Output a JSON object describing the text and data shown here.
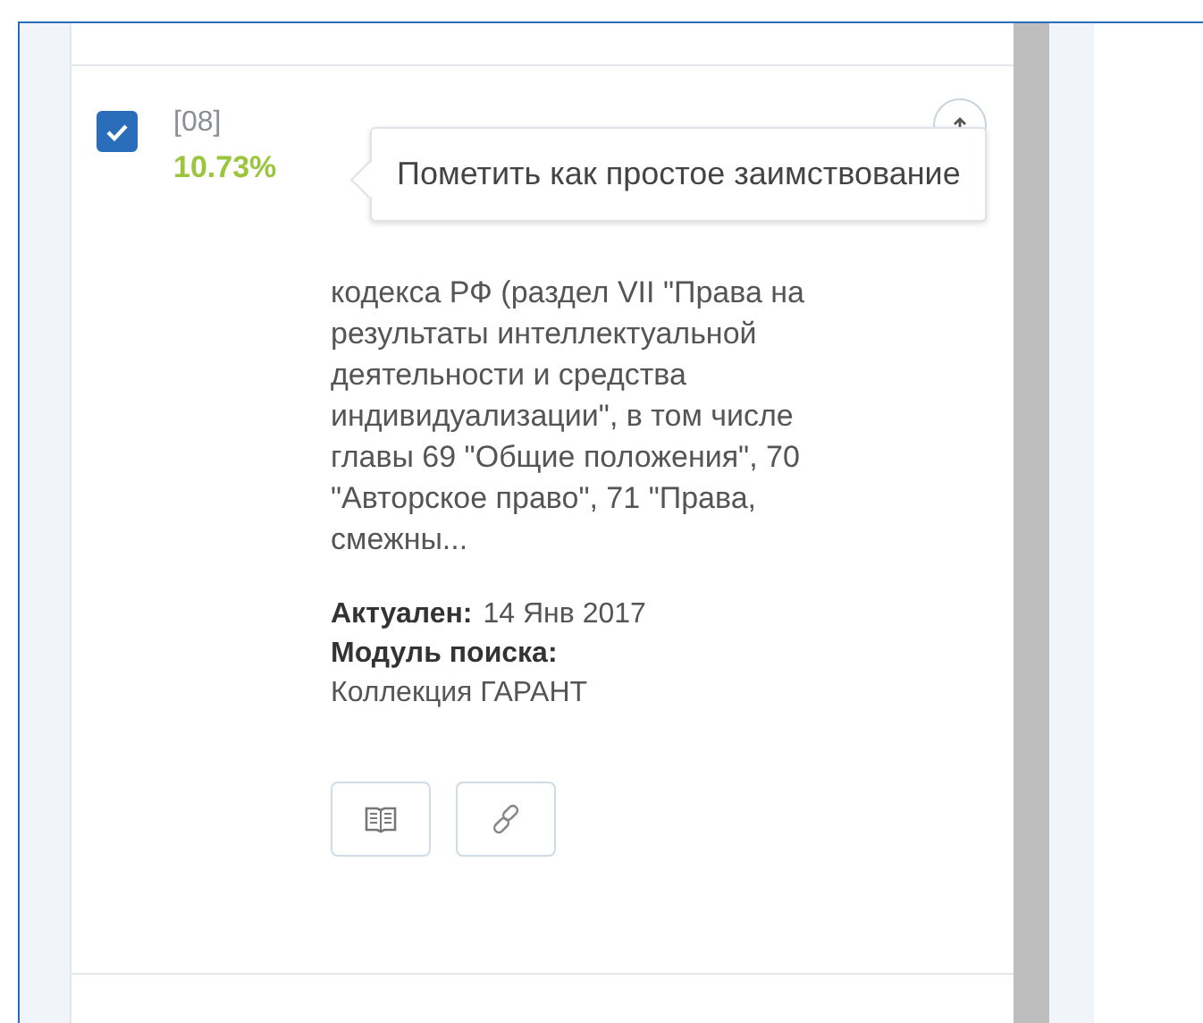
{
  "result": {
    "checked": true,
    "index": "[08]",
    "percent": "10.73%",
    "description": "кодекса РФ (раздел VII \"Права на результаты интеллектуальной деятельности и средства индивидуализации\", в том числе главы 69 \"Общие положения\", 70 \"Авторское право\", 71 \"Права, смежны...",
    "meta": [
      {
        "label": "Актуален:",
        "value": "14 Янв 2017",
        "kind": "inline"
      },
      {
        "label": "Модуль поиска:",
        "value": "Коллекция ГАРАНТ",
        "kind": "block"
      }
    ],
    "actions": [
      {
        "kind": "book"
      },
      {
        "kind": "link"
      }
    ]
  },
  "tooltip": {
    "text": "Пометить как простое заимствование"
  }
}
